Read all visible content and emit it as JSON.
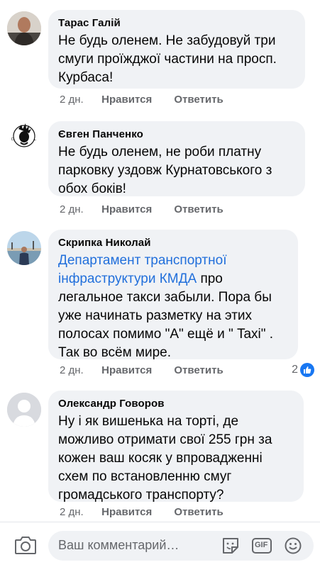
{
  "comments": [
    {
      "author": "Тарас Галій",
      "text": "Не будь оленем. Не забудовуй три смуги проїжджої частини на просп. Курбаса!",
      "age": "2 дн.",
      "like_label": "Нравится",
      "reply_label": "Ответить",
      "avatar_icon": "person-photo-avatar"
    },
    {
      "author": "Євген Панченко",
      "text": "Не будь оленем, не роби платну парковку уздовж Курнатовського з обох боків!",
      "age": "2 дн.",
      "like_label": "Нравится",
      "reply_label": "Ответить",
      "avatar_icon": "diesel-logo-avatar"
    },
    {
      "author": "Скрипка Николай",
      "mention": "Департамент транспортної інфраструктури КМДА",
      "text": " про легальное такси забыли. Пора бы уже начинать разметку на этих полосах помимо \"А\" ещё и \" Taxi\" . Так во всём мире.",
      "age": "2 дн.",
      "like_label": "Нравится",
      "reply_label": "Ответить",
      "reactions_count": "2",
      "avatar_icon": "seaside-photo-avatar"
    },
    {
      "author": "Олександр Говоров",
      "text": "Ну і як вишенька на торті, де можливо отримати свої 255 грн за кожен ваш косяк у впровадженні схем по встановленню смуг громадського транспорту?",
      "age": "2 дн.",
      "like_label": "Нравится",
      "reply_label": "Ответить",
      "avatar_icon": "default-avatar"
    }
  ],
  "composer": {
    "placeholder": "Ваш комментарий…",
    "icons": [
      "camera-icon",
      "sticker-icon",
      "gif-icon",
      "emoji-icon"
    ],
    "gif_label": "GIF"
  },
  "colors": {
    "bubble": "#f0f2f5",
    "link": "#216fdb",
    "meta": "#65676b",
    "like_badge": "#1877f2"
  }
}
